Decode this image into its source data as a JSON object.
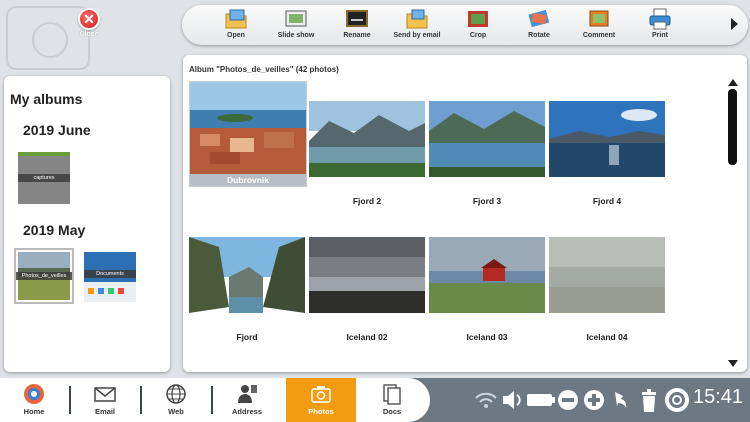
{
  "close": {
    "label": "Close"
  },
  "toolbar": {
    "open": "Open",
    "slideshow": "Slide show",
    "rename": "Rename",
    "send_email": "Send by email",
    "crop": "Crop",
    "rotate": "Rotate",
    "comment": "Comment",
    "print": "Print"
  },
  "albums": {
    "title": "My albums",
    "groups": [
      {
        "year": "2019 June",
        "items": [
          {
            "label": "captures"
          }
        ]
      },
      {
        "year": "2019 May",
        "items": [
          {
            "label": "Photos_de_veilles"
          },
          {
            "label": "Documents"
          }
        ]
      }
    ]
  },
  "main": {
    "header": "Album \"Photos_de_veilles\" (42 photos)",
    "photos": [
      {
        "caption": "Dubrovnik"
      },
      {
        "caption": "Fjord 2"
      },
      {
        "caption": "Fjord 3"
      },
      {
        "caption": "Fjord 4"
      },
      {
        "caption": "Fjord"
      },
      {
        "caption": "Iceland 02"
      },
      {
        "caption": "Iceland 03"
      },
      {
        "caption": "Iceland 04"
      }
    ]
  },
  "taskbar": {
    "home": "Home",
    "email": "Email",
    "web": "Web",
    "address": "Address",
    "photos": "Photos",
    "docs": "Docs",
    "clock": "15:41"
  },
  "colors": {
    "active_tab": "#f39c12",
    "taskbar_bg": "#6d7883",
    "close_red": "#d01818"
  }
}
